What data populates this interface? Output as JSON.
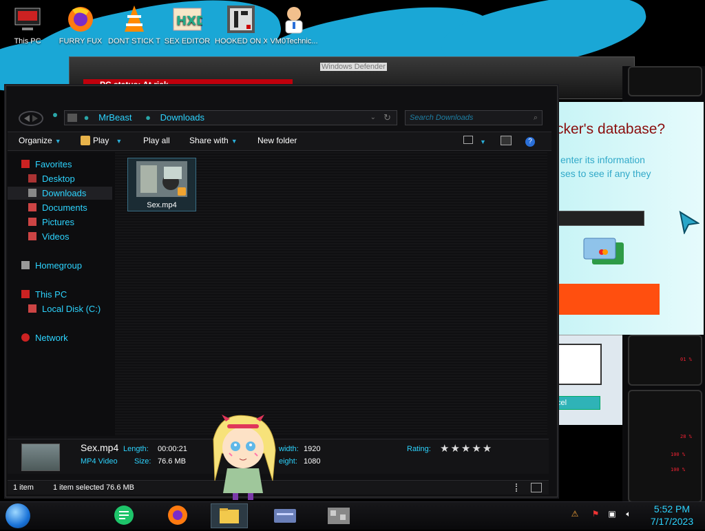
{
  "desktop": {
    "icons": [
      {
        "label": "This PC",
        "icon": "this-pc-icon"
      },
      {
        "label": "FURRY FUX",
        "icon": "firefox-icon"
      },
      {
        "label": "DONT STICK THIS IN YO...",
        "icon": "vlc-icon"
      },
      {
        "label": "SEX EDITOR",
        "icon": "hxd-editor-icon"
      },
      {
        "label": "HOOKED ON XONIX",
        "icon": "xonix-game-icon"
      },
      {
        "label": "VM0Technic...",
        "icon": "technician-icon"
      }
    ]
  },
  "defender_window": {
    "title": "Windows Defender",
    "status": "PC status: At risk"
  },
  "scam_window": {
    "heading": "cker's database?",
    "line1": "enter its information",
    "line2": "ses to see if any they",
    "cancel_label": "cel"
  },
  "explorer": {
    "breadcrumb": [
      "MrBeast",
      "Downloads"
    ],
    "search_placeholder": "Search Downloads",
    "toolbar": {
      "organize": "Organize",
      "play": "Play",
      "play_all": "Play all",
      "share_with": "Share with",
      "new_folder": "New folder"
    },
    "nav": {
      "favorites": "Favorites",
      "desktop": "Desktop",
      "downloads": "Downloads",
      "documents": "Documents",
      "pictures": "Pictures",
      "videos": "Videos",
      "homegroup": "Homegroup",
      "this_pc": "This PC",
      "local_disk": "Local Disk (C:)",
      "network": "Network"
    },
    "file": {
      "name": "Sex.mp4"
    },
    "details": {
      "name": "Sex.mp4",
      "type": "MP4 Video",
      "length_label": "Length:",
      "length": "00:00:21",
      "size_label": "Size:",
      "size": "76.6 MB",
      "width_label": "width:",
      "width": "1920",
      "height_label": "eight:",
      "height": "1080",
      "rating_label": "Rating:",
      "rating": "★★★★★"
    },
    "status": {
      "items": "1 item",
      "selected": "1 item selected  76.6 MB"
    }
  },
  "hud": {
    "readouts": [
      "01 %",
      "28 %",
      "100 %",
      "100 %"
    ]
  },
  "taskbar": {
    "clock_time": "5:52 PM",
    "clock_date": "7/17/2023",
    "accent": "#2dd4ff"
  }
}
